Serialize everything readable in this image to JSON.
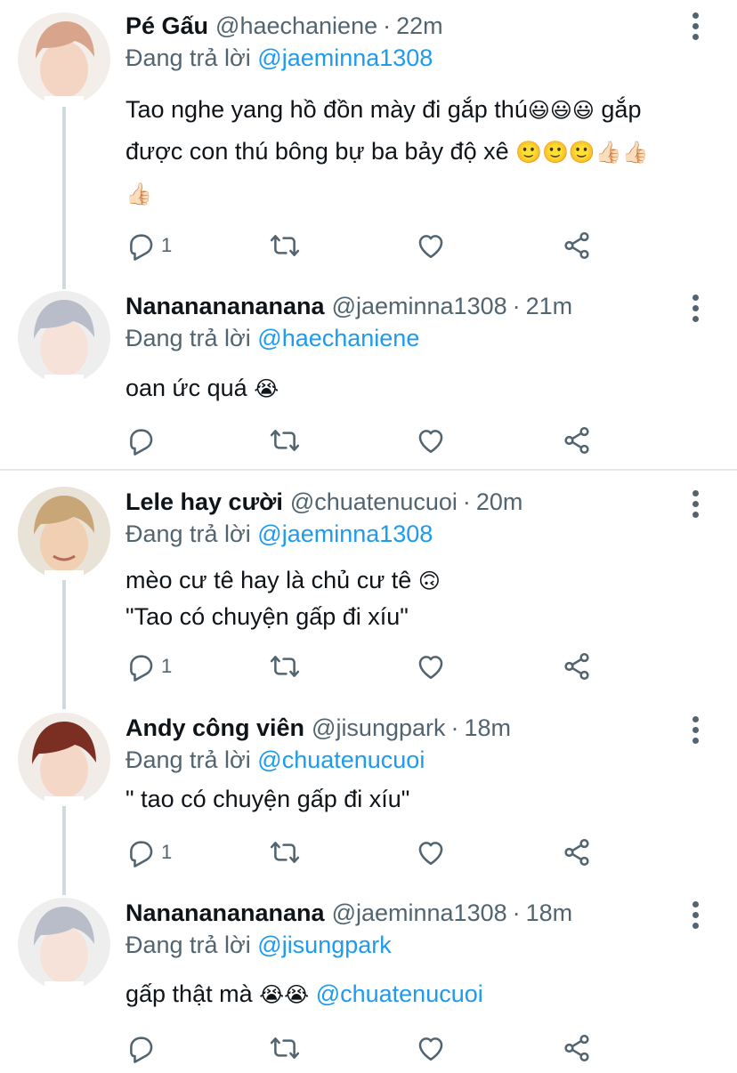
{
  "tweets": [
    {
      "name": "Pé Gấu",
      "handle": "@haechaniene",
      "time": "22m",
      "replying_label": "Đang trả lời",
      "replying_to": "@jaeminna1308",
      "text_line1": "Tao nghe yang hồ đồn mày đi gắp thú",
      "emoji_a": "😃😃😃",
      "text_line1b": " gắp",
      "text_line2": "được con thú bông bự ba bảy độ xê ",
      "emoji_b": "🙂🙂🙂👍🏻👍🏻",
      "emoji_c": "👍🏻",
      "reply_count": "1",
      "avatar_hair": "#d8a58c"
    },
    {
      "name": "Nanananananana",
      "handle": "@jaeminna1308",
      "time": "21m",
      "replying_label": "Đang trả lời",
      "replying_to": "@haechaniene",
      "text": "oan ức quá ",
      "emoji": "😭",
      "reply_count": "",
      "avatar_hair": "#b9bcc9"
    },
    {
      "name": "Lele hay cười",
      "handle": "@chuatenucuoi",
      "time": "20m",
      "replying_label": "Đang trả lời",
      "replying_to": "@jaeminna1308",
      "text_line1": "mèo cư tê hay là chủ cư tê ",
      "emoji": "🙃",
      "text_line2": "\"Tao có chuyện gấp đi xíu\"",
      "reply_count": "1",
      "avatar_hair": "#c9a678"
    },
    {
      "name": "Andy công viên",
      "handle": "@jisungpark",
      "time": "18m",
      "replying_label": "Đang trả lời",
      "replying_to": "@chuatenucuoi",
      "text": "\" tao có chuyện gấp đi xíu\"",
      "reply_count": "1",
      "avatar_hair": "#7a2f22"
    },
    {
      "name": "Nanananananana",
      "handle": "@jaeminna1308",
      "time": "18m",
      "replying_label": "Đang trả lời",
      "replying_to": "@jisungpark",
      "text": "gấp thật mà ",
      "emoji": "😭😭",
      "mention": " @chuatenucuoi",
      "reply_count": "",
      "avatar_hair": "#b9bcc9"
    }
  ],
  "icons": {
    "reply": "reply-icon",
    "retweet": "retweet-icon",
    "like": "like-icon",
    "share": "share-icon",
    "more": "more-icon"
  },
  "colors": {
    "link": "#1d9bf0",
    "muted": "#536471",
    "thread_line": "#cfd9de"
  }
}
